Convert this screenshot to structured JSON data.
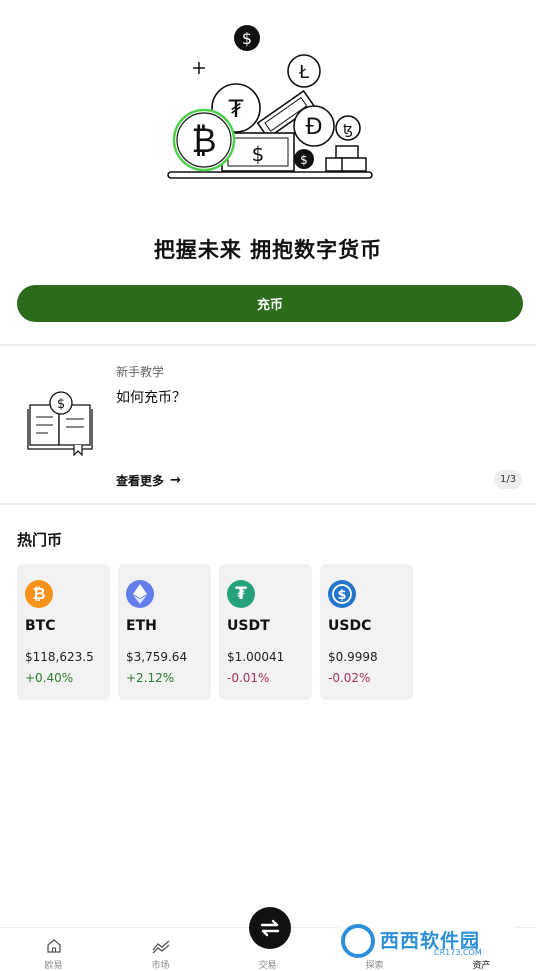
{
  "hero": {
    "illustration": "crypto-coins-illustration",
    "headline": "把握未来 拥抱数字货币"
  },
  "deposit_button": {
    "label": "充币"
  },
  "tutorial": {
    "category": "新手教学",
    "title": "如何充币？",
    "more_label": "查看更多",
    "pager": "1/3"
  },
  "hot_coins": {
    "title": "热门币",
    "coins": [
      {
        "symbol": "BTC",
        "price": "$118,623.5",
        "change": "+0.40%",
        "direction": "up",
        "icon": "bitcoin-icon",
        "color": "#f7931a"
      },
      {
        "symbol": "ETH",
        "price": "$3,759.64",
        "change": "+2.12%",
        "direction": "up",
        "icon": "ethereum-icon",
        "color": "#627eea"
      },
      {
        "symbol": "USDT",
        "price": "$1.00041",
        "change": "-0.01%",
        "direction": "down",
        "icon": "tether-icon",
        "color": "#26a17b"
      },
      {
        "symbol": "USDC",
        "price": "$0.9998",
        "change": "-0.02%",
        "direction": "down",
        "icon": "usdc-icon",
        "color": "#2775ca"
      }
    ]
  },
  "tabbar": {
    "tabs": [
      {
        "label": "欧易",
        "icon": "home-icon"
      },
      {
        "label": "市场",
        "icon": "market-chart-icon"
      },
      {
        "label": "交易",
        "icon": "trade-swap-icon"
      },
      {
        "label": "探索",
        "icon": "explore-icon"
      },
      {
        "label": "资产",
        "icon": "wallet-icon"
      }
    ]
  },
  "watermark": {
    "text": "西西软件园",
    "subtext": "CR173.COM"
  },
  "colors": {
    "brand_green": "#2b6b1b",
    "up": "#2e7d32",
    "down": "#a8385a",
    "card_bg": "#f2f2f2"
  }
}
